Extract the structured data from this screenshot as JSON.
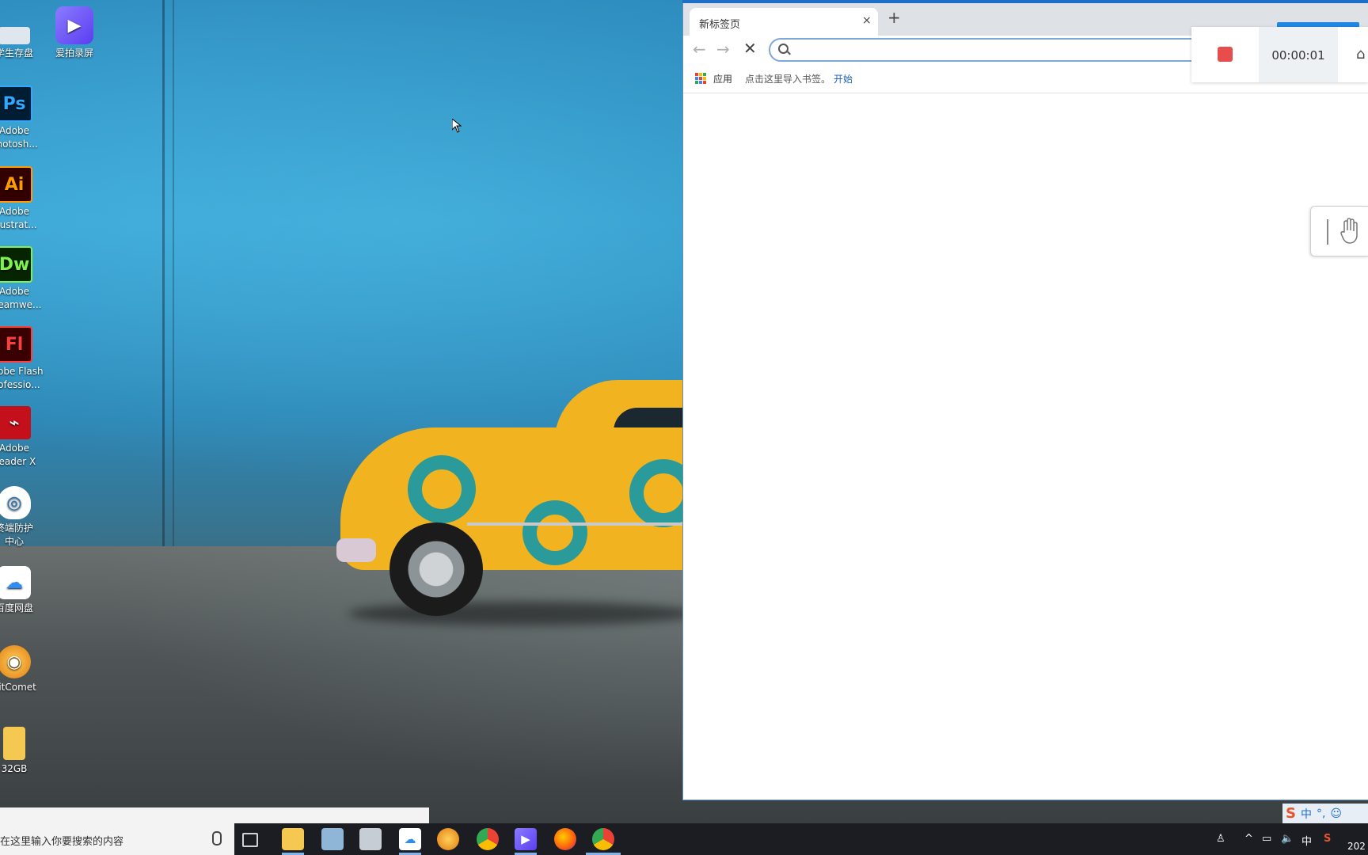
{
  "desktop": {
    "icons": [
      {
        "label": "学生存盘",
        "glyph": "",
        "color": "#dfe6ee",
        "name": "desktop-icon-student-disk"
      },
      {
        "label": "爱拍录屏",
        "glyph": "▶",
        "color": "#6f5cf0",
        "name": "desktop-icon-aipai-recorder"
      },
      {
        "label1": "Adobe",
        "label2": "Photosh...",
        "glyph": "Ps",
        "color": "#001d34",
        "fg": "#31a8ff",
        "name": "desktop-icon-photoshop"
      },
      {
        "label1": "Adobe",
        "label2": "Illustrat...",
        "glyph": "Ai",
        "color": "#330000",
        "fg": "#ff9a00",
        "name": "desktop-icon-illustrator"
      },
      {
        "label1": "Adobe",
        "label2": "Dreamwe...",
        "glyph": "Dw",
        "color": "#072401",
        "fg": "#7cf34e",
        "name": "desktop-icon-dreamweaver"
      },
      {
        "label1": "Adobe Flash",
        "label2": "Professio...",
        "glyph": "Fl",
        "color": "#3a0000",
        "fg": "#ff3d3d",
        "name": "desktop-icon-flash"
      },
      {
        "label1": "Adobe",
        "label2": "Reader X",
        "glyph": "⌁",
        "color": "#ffffff",
        "fg": "#d3101b",
        "name": "desktop-icon-reader"
      },
      {
        "label1": "终端防护",
        "label2": "中心",
        "glyph": "◎",
        "color": "#ffffff",
        "fg": "#2273b5",
        "name": "desktop-icon-endpoint-protection"
      },
      {
        "label1": "百度网盘",
        "label2": "",
        "glyph": "☁",
        "color": "#ffffff",
        "fg": "#2f8cf0",
        "name": "desktop-icon-baidu-netdisk"
      },
      {
        "label1": "BitComet",
        "label2": "",
        "glyph": "◉",
        "color": "#f4a02b",
        "fg": "#ffffff",
        "name": "desktop-icon-bitcomet"
      },
      {
        "label1": "32GB",
        "label2": "",
        "glyph": "▮",
        "color": "#f5c951",
        "fg": "#e0a92a",
        "name": "desktop-icon-usb-32gb"
      }
    ]
  },
  "browser": {
    "tab_title": "新标签页",
    "tab_close": "×",
    "new_tab": "+",
    "back": "←",
    "forward": "→",
    "stop": "✕",
    "omnibox_value": "",
    "bookmarks": {
      "apps_label": "应用",
      "import_text": "点击这里导入书签。",
      "start_link": "开始"
    }
  },
  "recorder": {
    "time": "00:00:01",
    "home": "⌂"
  },
  "taskbar": {
    "search_placeholder": "在这里输入你要搜索的内容",
    "items": [
      "task-view",
      "file-explorer",
      "notepad",
      "remote-desktop",
      "baidu-netdisk",
      "bitcomet",
      "chrome-1",
      "aipai-recorder",
      "firefox",
      "chrome-2"
    ],
    "tray_lang": "中",
    "tray_ime": "中",
    "date_fragment": "202"
  }
}
